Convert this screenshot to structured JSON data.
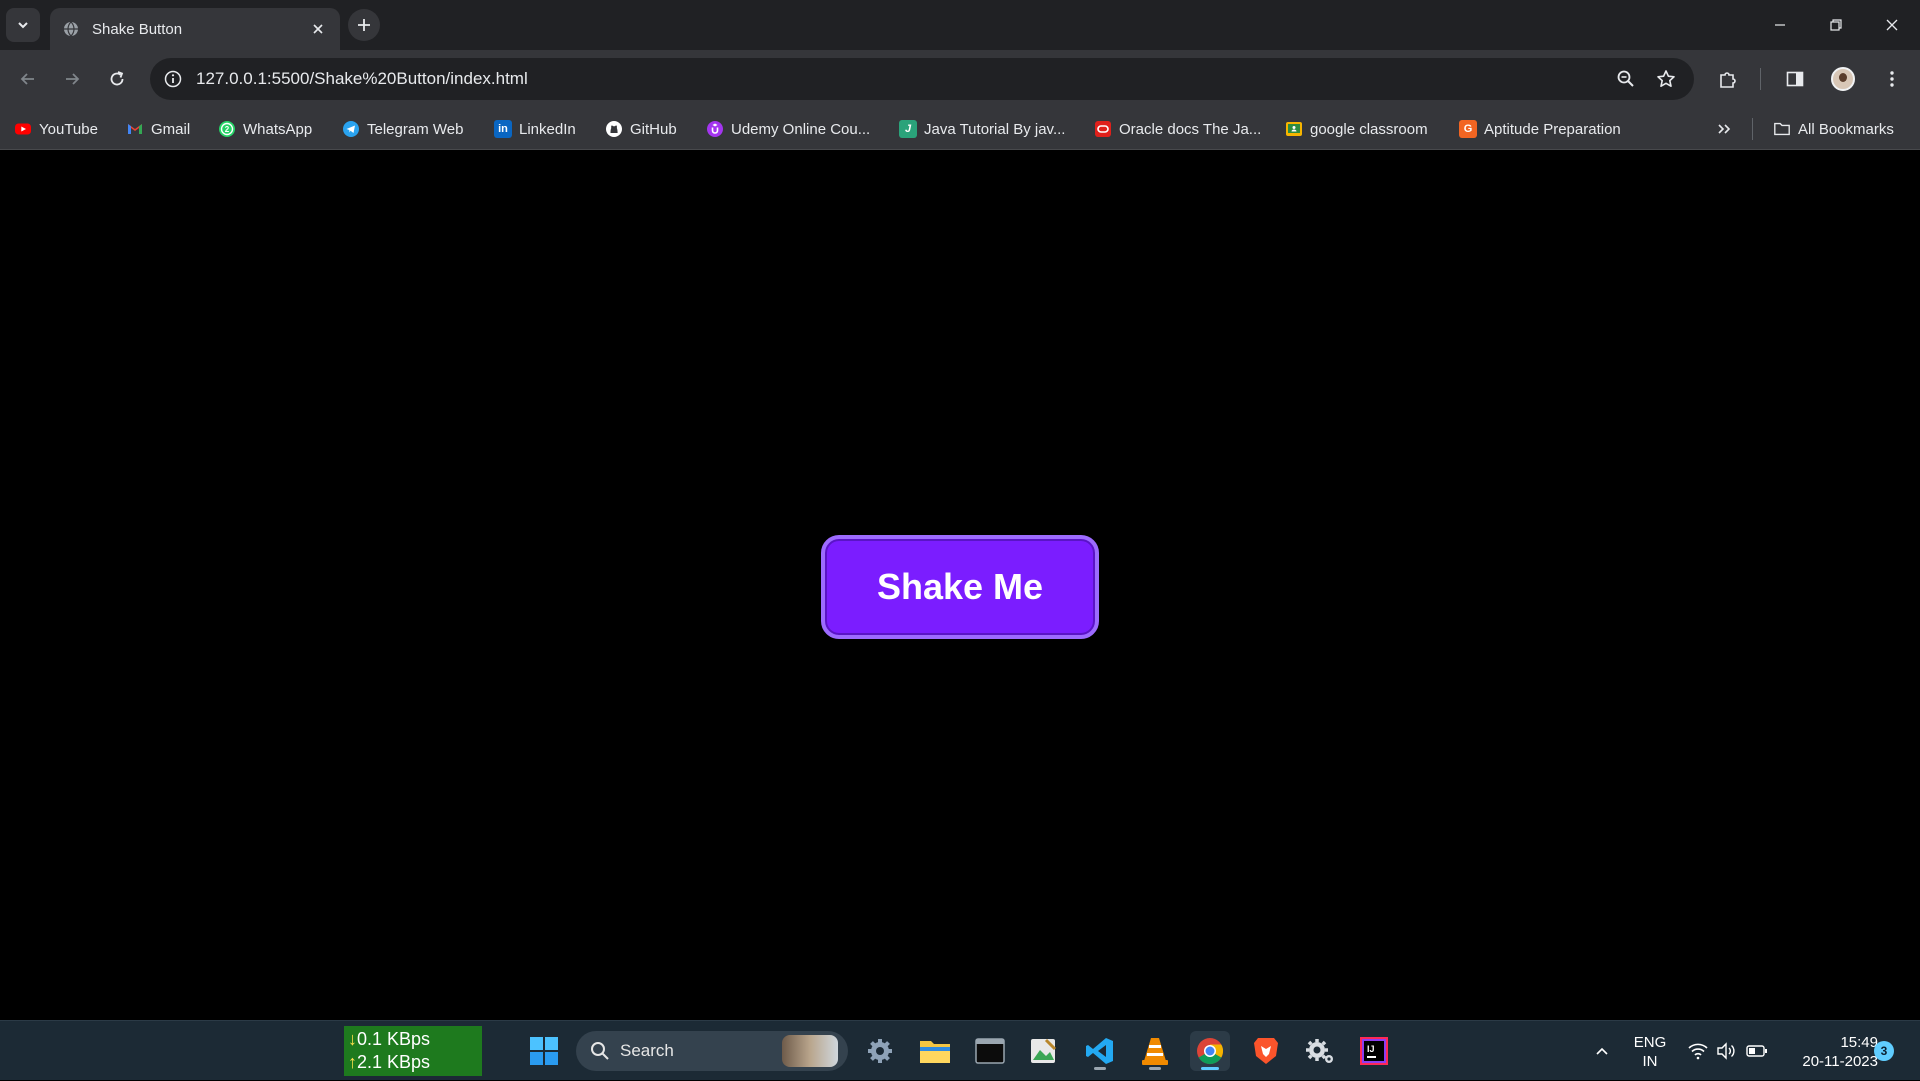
{
  "browser": {
    "tab": {
      "title": "Shake Button"
    },
    "omnibox": {
      "url": "127.0.0.1:5500/Shake%20Button/index.html"
    },
    "bookmarks": [
      {
        "label": "YouTube",
        "icon": "youtube-icon",
        "color": "#ff0000"
      },
      {
        "label": "Gmail",
        "icon": "gmail-icon",
        "color": "#ea4335"
      },
      {
        "label": "WhatsApp",
        "icon": "whatsapp-icon",
        "color": "#25d366"
      },
      {
        "label": "Telegram Web",
        "icon": "telegram-icon",
        "color": "#2aa3ef"
      },
      {
        "label": "LinkedIn",
        "icon": "linkedin-icon",
        "color": "#0a66c2"
      },
      {
        "label": "GitHub",
        "icon": "github-icon",
        "color": "#ffffff"
      },
      {
        "label": "Udemy Online Cou...",
        "icon": "udemy-icon",
        "color": "#a435f0"
      },
      {
        "label": "Java Tutorial By jav...",
        "icon": "javatpoint-icon",
        "color": "#2aa37a"
      },
      {
        "label": "Oracle docs The Ja...",
        "icon": "oracle-icon",
        "color": "#e0201b"
      },
      {
        "label": "google classroom",
        "icon": "classroom-icon",
        "color": "#f7b500"
      },
      {
        "label": "Aptitude Preparation",
        "icon": "indiabix-icon",
        "color": "#f26522"
      }
    ],
    "all_bookmarks_label": "All Bookmarks"
  },
  "page": {
    "button_label": "Shake Me",
    "button_color": "#7b1dff",
    "background": "#000000"
  },
  "taskbar": {
    "net_down": "0.1 KBps",
    "net_up": "2.1 KBps",
    "search_label": "Search",
    "lang_line1": "ENG",
    "lang_line2": "IN",
    "time": "15:49",
    "date": "20-11-2023",
    "notification_count": "3"
  }
}
